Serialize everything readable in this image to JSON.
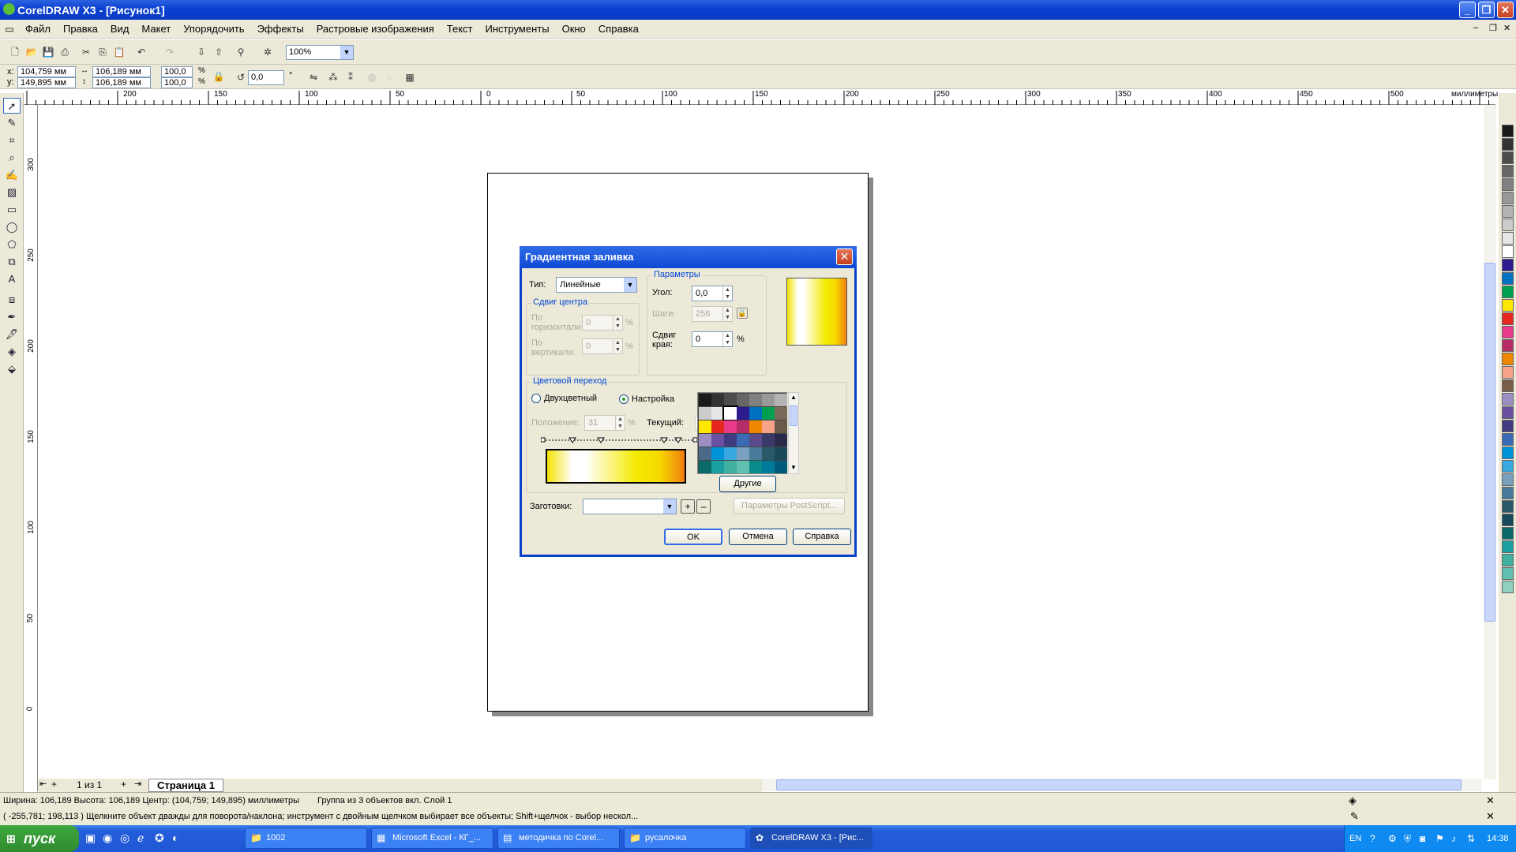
{
  "window": {
    "title": "CorelDRAW X3 - [Рисунок1]"
  },
  "menu": [
    "Файл",
    "Правка",
    "Вид",
    "Макет",
    "Упорядочить",
    "Эффекты",
    "Растровые изображения",
    "Текст",
    "Инструменты",
    "Окно",
    "Справка"
  ],
  "toolbar": {
    "zoom": "100%"
  },
  "propbar": {
    "x": "104,759 мм",
    "y": "149,895 мм",
    "w": "106,189 мм",
    "h": "106,189 мм",
    "sx": "100,0",
    "sy": "100,0",
    "pct1": "%",
    "pct2": "%",
    "angle": "0,0",
    "deg": "°"
  },
  "ruler": {
    "units": "миллиметры",
    "h_ticks": [
      "200",
      "150",
      "100",
      "50",
      "0",
      "50",
      "100",
      "150",
      "200",
      "250",
      "300",
      "350",
      "400",
      "450",
      "500"
    ],
    "v_ticks": [
      "300",
      "250",
      "200",
      "150",
      "100",
      "50",
      "0"
    ]
  },
  "pages": {
    "counter": "1 из 1",
    "tab": "Страница 1"
  },
  "dialog": {
    "title": "Градиентная заливка",
    "type_label": "Тип:",
    "type_value": "Линейные",
    "center_group": "Сдвиг центра",
    "horiz_label": "По горизонтали:",
    "horiz_value": "0",
    "vert_label": "По вертикали:",
    "vert_value": "0",
    "params_group": "Параметры",
    "angle_label": "Угол:",
    "angle_value": "0,0",
    "steps_label": "Шаги:",
    "steps_value": "256",
    "edge_label": "Сдвиг края:",
    "edge_value": "0",
    "color_group": "Цветовой переход",
    "two_color": "Двухцветный",
    "custom": "Настройка",
    "position_label": "Положение:",
    "position_value": "31",
    "current_label": "Текущий:",
    "others": "Другие",
    "presets_label": "Заготовки:",
    "postscript": "Параметры PostScript...",
    "ok": "OK",
    "cancel": "Отмена",
    "help": "Справка",
    "percent": "%"
  },
  "status": {
    "line1_left": "Ширина: 106,189 Высота: 106,189 Центр: (104,759; 149,895) миллиметры",
    "line1_right": "Группа из 3 объектов вкл. Слой 1",
    "line2": "( -255,781; 198,113 )   Щелкните объект дважды для поворота/наклона; инструмент с двойным щелчком выбирает все объекты; Shift+щелчок - выбор нескол..."
  },
  "taskbar": {
    "start": "пуск",
    "tasks": [
      "1002",
      "Microsoft Excel - КГ_...",
      "методичка по Corel...",
      "русалочка",
      "CorelDRAW X3 - [Рис..."
    ],
    "lang": "EN",
    "time": "14:38"
  }
}
